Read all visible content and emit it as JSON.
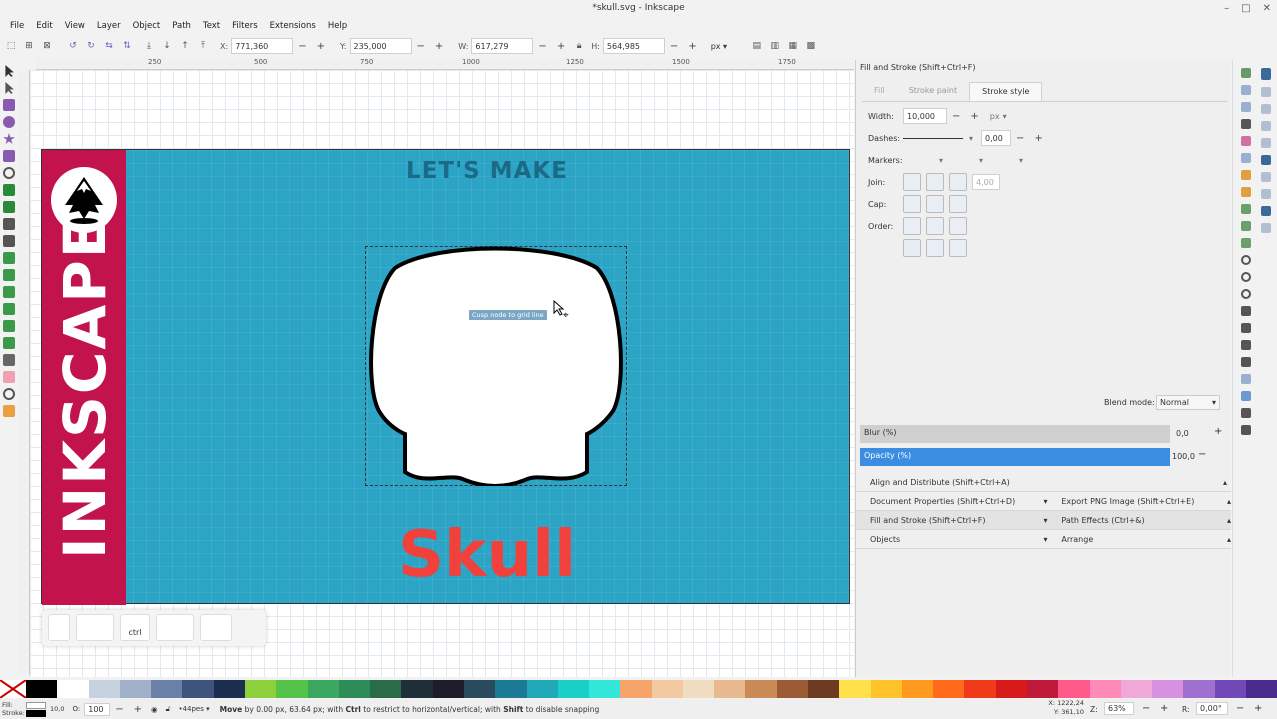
{
  "window": {
    "title": "*skull.svg - Inkscape"
  },
  "menu": [
    "File",
    "Edit",
    "View",
    "Layer",
    "Object",
    "Path",
    "Text",
    "Filters",
    "Extensions",
    "Help"
  ],
  "toolctrl": {
    "x_label": "X:",
    "x": "771,360",
    "y_label": "Y:",
    "y": "235,000",
    "w_label": "W:",
    "w": "617,279",
    "h_label": "H:",
    "h": "564,985",
    "unit": "px"
  },
  "ruler": {
    "ticks": [
      "250",
      "500",
      "750",
      "1000",
      "1250",
      "1500",
      "1750"
    ]
  },
  "canvas": {
    "band_text": "INKSCAPE",
    "heading": "LET'S MAKE",
    "title": "Skull",
    "tooltip": "Cusp node to grid line",
    "key_ctrl": "ctrl"
  },
  "fill_stroke": {
    "title": "Fill and Stroke (Shift+Ctrl+F)",
    "tabs": [
      "Fill",
      "Stroke paint",
      "Stroke style"
    ],
    "width_label": "Width:",
    "width": "10,000",
    "width_unit": "px",
    "dashes_label": "Dashes:",
    "dashes": "0,00",
    "markers_label": "Markers:",
    "join_label": "Join:",
    "miter": "4,00",
    "cap_label": "Cap:",
    "order_label": "Order:",
    "blend_label": "Blend mode:",
    "blend": "Normal",
    "blur_label": "Blur (%)",
    "blur": "0,0",
    "opacity_label": "Opacity (%)",
    "opacity": "100,0"
  },
  "docks": {
    "align": "Align and Distribute (Shift+Ctrl+A)",
    "docprops": "Document Properties (Shift+Ctrl+D)",
    "export": "Export PNG Image (Shift+Ctrl+E)",
    "fillstroke": "Fill and Stroke (Shift+Ctrl+F)",
    "patheffects": "Path Effects (Ctrl+&)",
    "objects": "Objects",
    "arrange": "Arrange"
  },
  "status": {
    "fill_label": "Fill:",
    "stroke_label": "Stroke:",
    "stroke_w": "10,0",
    "opacity_label": "O:",
    "opacity": "100",
    "layer": "•44pes",
    "message_bold": "Move",
    "message": "by 0.00 px, 63.64 px; with ",
    "msg_ctrl": "Ctrl",
    "msg_mid": " to restrict to horizontal/vertical; with ",
    "msg_shift": "Shift",
    "msg_end": " to disable snapping",
    "x_label": "X:",
    "x": "1222,24",
    "y_label": "Y:",
    "y": "361,10",
    "zoom_label": "Z:",
    "zoom": "63%",
    "rot_label": "R:",
    "rotation": "0,00°"
  },
  "palette_colors": [
    "#000000",
    "#ffffff",
    "#c7d2e0",
    "#9fb0c8",
    "#6b80a6",
    "#3d547e",
    "#1c2e4f",
    "#8dd03c",
    "#55c24a",
    "#3aa860",
    "#2d8c58",
    "#2a6b48",
    "#1e2f3a",
    "#1d1d2a",
    "#2a4a5e",
    "#1b7a96",
    "#1fa8b8",
    "#18d0c8",
    "#32e6d8",
    "#f7a46a",
    "#f2c9a0",
    "#f0dcc0",
    "#e8b88e",
    "#c98a55",
    "#9a5a34",
    "#6d3a22",
    "#ffe04a",
    "#ffc229",
    "#ff9a1f",
    "#ff6a1a",
    "#f03a1a",
    "#d81a1a",
    "#c01a3a",
    "#ff5a8a",
    "#ff8ab8",
    "#f0a8d8",
    "#d890e0",
    "#a070d0",
    "#7048b8",
    "#4a2a8c"
  ]
}
